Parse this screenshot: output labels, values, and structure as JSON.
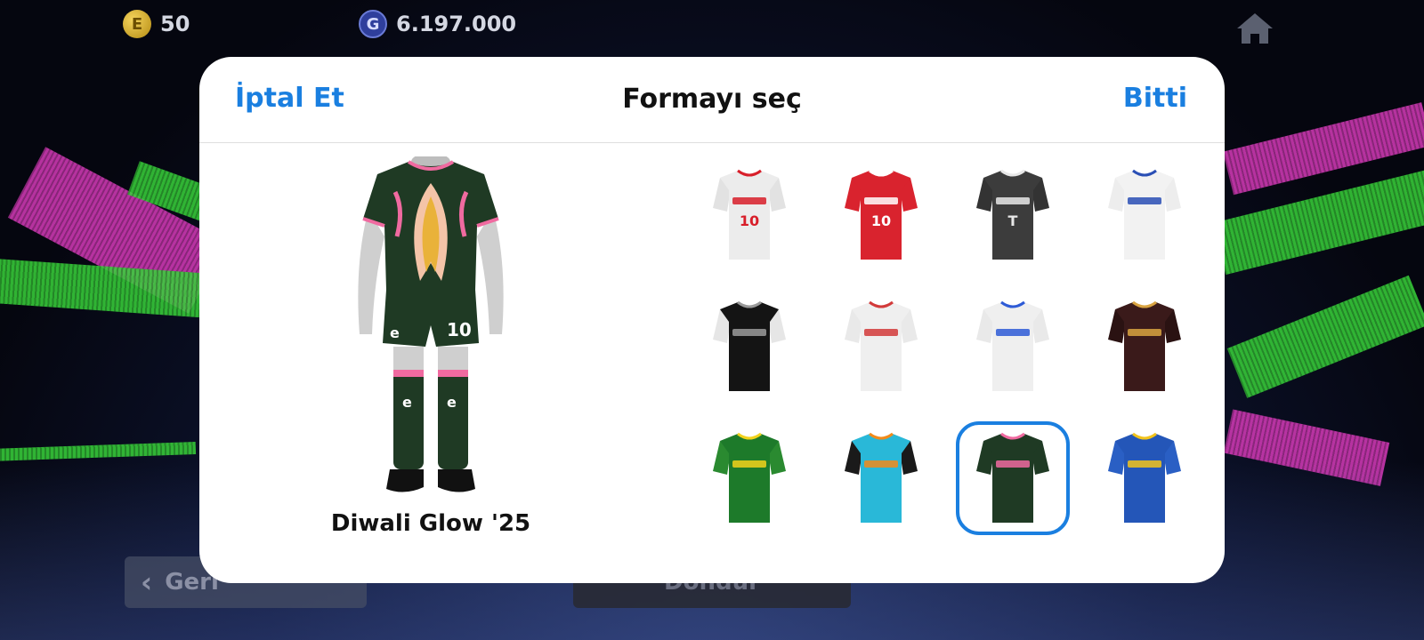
{
  "hud": {
    "coins_e": "50",
    "coins_e_glyph": "E",
    "coins_g": "6.197.000",
    "coins_g_glyph": "G"
  },
  "background_buttons": {
    "back_label": "Geri",
    "center_label": "Döndür"
  },
  "dialog": {
    "cancel_label": "İptal Et",
    "title": "Formayı seç",
    "done_label": "Bitti",
    "selected_kit_name": "Diwali Glow '25",
    "selected_index": 10
  },
  "kits": [
    {
      "icon": "jersey-turkey-white-icon",
      "body": "#ececec",
      "sleeve": "#e2e2e2",
      "accent": "#d81f2a",
      "number": "10"
    },
    {
      "icon": "jersey-turkey-red-icon",
      "body": "#d9232e",
      "sleeve": "#d9232e",
      "accent": "#ffffff",
      "number": "10"
    },
    {
      "icon": "jersey-black-t-icon",
      "body": "#3c3c3c",
      "sleeve": "#333333",
      "accent": "#e8e8e8",
      "number": "T"
    },
    {
      "icon": "jersey-white-blue-collar-icon",
      "body": "#f2f2f2",
      "sleeve": "#ededed",
      "accent": "#2a4fb5",
      "number": ""
    },
    {
      "icon": "jersey-black-white-sleeve-icon",
      "body": "#141414",
      "sleeve": "#e6e6e6",
      "accent": "#9a9a9a",
      "number": ""
    },
    {
      "icon": "jersey-white-red-print-icon",
      "body": "#efefef",
      "sleeve": "#e9e9e9",
      "accent": "#d23a3a",
      "number": ""
    },
    {
      "icon": "jersey-white-tricolor-icon",
      "body": "#efefef",
      "sleeve": "#e9e9e9",
      "accent": "#2e5bd6",
      "number": ""
    },
    {
      "icon": "jersey-maroon-gold-icon",
      "body": "#3a1a1a",
      "sleeve": "#2a1212",
      "accent": "#d9a441",
      "number": ""
    },
    {
      "icon": "jersey-green-yellow-icon",
      "body": "#1d7a2a",
      "sleeve": "#2a8a30",
      "accent": "#f2d21b",
      "number": ""
    },
    {
      "icon": "jersey-cyan-orange-icon",
      "body": "#29b8d8",
      "sleeve": "#1a1a1a",
      "accent": "#f28a1a",
      "number": ""
    },
    {
      "icon": "jersey-diwali-glow-icon",
      "body": "#1f3a24",
      "sleeve": "#1f3a24",
      "accent": "#f06aa0",
      "number": ""
    },
    {
      "icon": "jersey-blue-pattern-icon",
      "body": "#2456b8",
      "sleeve": "#2a5fc4",
      "accent": "#f2c31b",
      "number": ""
    }
  ]
}
